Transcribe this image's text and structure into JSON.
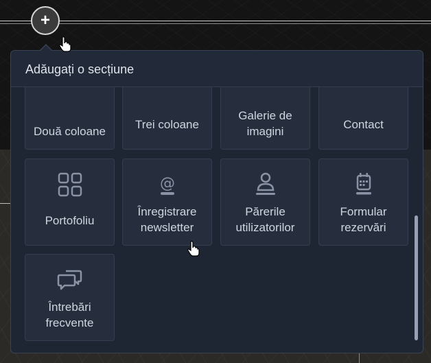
{
  "panel": {
    "title": "Adăugați o secțiune"
  },
  "tiles_top_row": [
    {
      "label": "Două coloane",
      "icon": "two-columns-icon"
    },
    {
      "label": "Trei coloane",
      "icon": "three-columns-icon"
    },
    {
      "label": "Galerie de imagini",
      "icon": "gallery-icon"
    },
    {
      "label": "Contact",
      "icon": "contact-icon"
    }
  ],
  "tiles": [
    {
      "label": "Portofoliu",
      "icon": "grid-icon"
    },
    {
      "label": "Înregistrare newsletter",
      "icon": "at-sign-icon"
    },
    {
      "label": "Părerile utilizatorilor",
      "icon": "user-icon"
    },
    {
      "label": "Formular rezervări",
      "icon": "calendar-icon"
    },
    {
      "label": "Întrebări frecvente",
      "icon": "chat-bubbles-icon"
    }
  ],
  "colors": {
    "panel_bg": "#1e2533",
    "tile_bg": "#262e3d",
    "icon": "#8a93a5",
    "text": "#cfd5df"
  },
  "add_button_label": "+"
}
